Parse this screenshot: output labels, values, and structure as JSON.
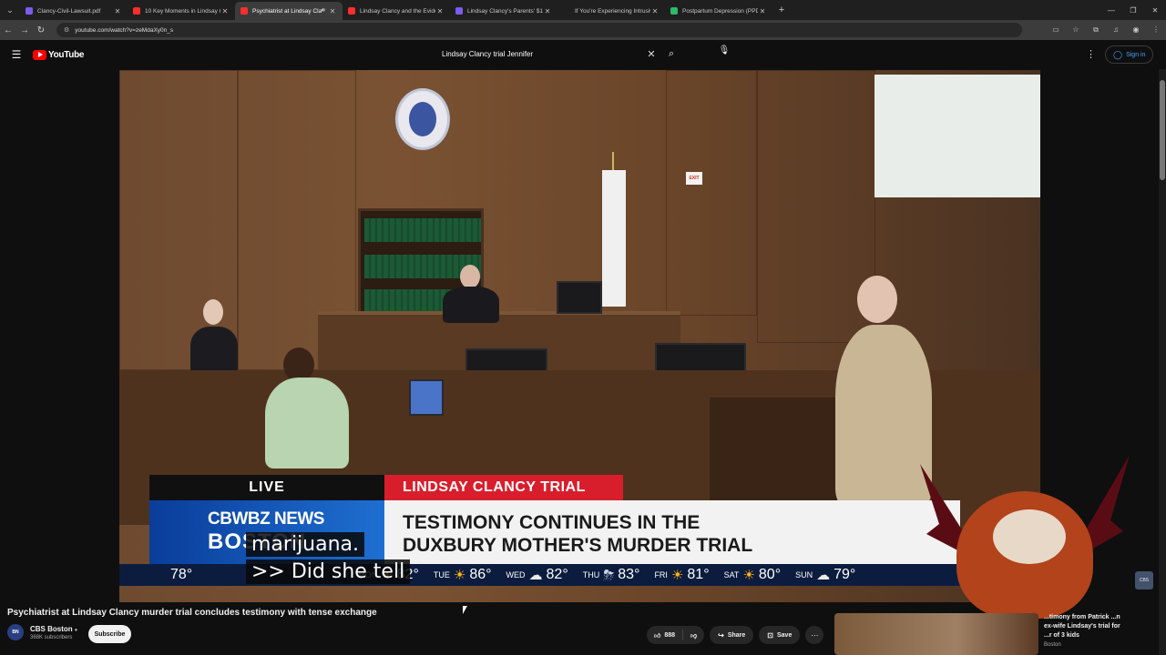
{
  "browser": {
    "tabs": [
      {
        "title": "Clancy-Civil-Lawsuit.pdf",
        "favicon_color": "#7b5cf0"
      },
      {
        "title": "10 Key Moments in Lindsay Cla",
        "favicon_color": "#ff2d2d"
      },
      {
        "title": "Psychiatrist at Lindsay Clan",
        "favicon_color": "#ff2d2d",
        "active": true,
        "audio": true
      },
      {
        "title": "Lindsay Clancy and the Eviden",
        "favicon_color": "#ff2d2d"
      },
      {
        "title": "Lindsay Clancy's Parents' $1 Mi",
        "favicon_color": "#7b5cf0"
      },
      {
        "title": "If You're Experiencing Intrusiv",
        "favicon_color": "#1f1f1f"
      },
      {
        "title": "Postpartum Depression (PPD)",
        "favicon_color": "#2fb86a"
      }
    ],
    "url": "youtube.com/watch?v=zeMdaXy0n_s"
  },
  "youtube": {
    "logo_text": "YouTube",
    "search_query": "Lindsay Clancy trial Jennifer",
    "sign_in": "Sign in"
  },
  "video": {
    "lower_third": {
      "live": "LIVE",
      "tag": "LINDSAY CLANCY TRIAL",
      "brand_line1": "CBWBZ NEWS",
      "brand_line2": "BOSTON",
      "headline_line1": "TESTIMONY CONTINUES IN THE",
      "headline_line2": "DUXBURY MOTHER'S MURDER TRIAL"
    },
    "exit_sign": "EXIT",
    "ticker": {
      "current_temp": "78°",
      "days": [
        {
          "day": "MON",
          "icon": "sun",
          "temp": "82°"
        },
        {
          "day": "TUE",
          "icon": "sun",
          "temp": "86°"
        },
        {
          "day": "WED",
          "icon": "cloud",
          "temp": "82°"
        },
        {
          "day": "THU",
          "icon": "tstorm",
          "temp": "83°"
        },
        {
          "day": "FRI",
          "icon": "sun",
          "temp": "81°"
        },
        {
          "day": "SAT",
          "icon": "sun",
          "temp": "80°"
        },
        {
          "day": "SUN",
          "icon": "cloud",
          "temp": "79°"
        }
      ]
    },
    "captions": [
      "marijuana.",
      ">> Did she tell"
    ],
    "corner_badge": "CBS"
  },
  "watch": {
    "title": "Psychiatrist at Lindsay Clancy murder trial concludes testimony with tense exchange",
    "channel_name": "CBS Boston",
    "channel_initials": "BN",
    "subscribers": "368K subscribers",
    "subscribe": "Subscribe",
    "likes": "888",
    "share": "Share",
    "save": "Save"
  },
  "recommended": {
    "title": "...timony from Patrick ...n ex-wife Lindsay's trial for ...r of 3 kids",
    "channel": "Boston"
  },
  "colors": {
    "youtube_red": "#ff0000",
    "breaking_red": "#d81e2c",
    "link_blue": "#3ea6ff"
  }
}
